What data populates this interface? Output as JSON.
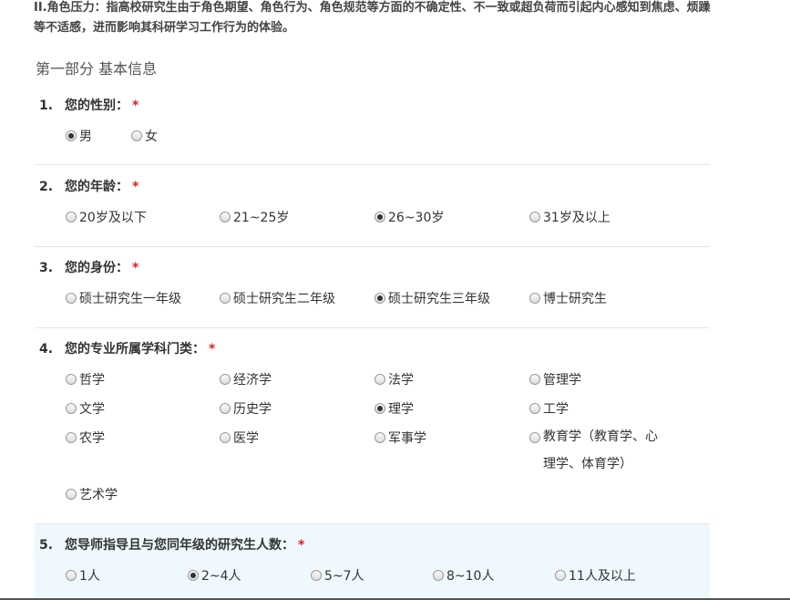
{
  "intro_text": "II.角色压力：指高校研究生由于角色期望、角色行为、角色规范等方面的不确定性、不一致或超负荷而引起内心感知到焦虑、烦躁等不适感，进而影响其科研学习工作行为的体验。",
  "part_title": "第一部分 基本信息",
  "required_mark": "*",
  "questions": [
    {
      "num": "1.",
      "text": "您的性别：",
      "options": [
        "男",
        "女"
      ],
      "selected": 0
    },
    {
      "num": "2.",
      "text": "您的年龄：",
      "options": [
        "20岁及以下",
        "21~25岁",
        "26~30岁",
        "31岁及以上"
      ],
      "selected": 2
    },
    {
      "num": "3.",
      "text": "您的身份：",
      "options": [
        "硕士研究生一年级",
        "硕士研究生二年级",
        "硕士研究生三年级",
        "博士研究生"
      ],
      "selected": 2
    },
    {
      "num": "4.",
      "text": "您的专业所属学科门类：",
      "options": [
        "哲学",
        "经济学",
        "法学",
        "管理学",
        "文学",
        "历史学",
        "理学",
        "工学",
        "农学",
        "医学",
        "军事学",
        "教育学（教育学、心理学、体育学）",
        "艺术学"
      ],
      "selected": 6
    },
    {
      "num": "5.",
      "text": "您导师指导且与您同年级的研究生人数：",
      "options": [
        "1人",
        "2~4人",
        "5~7人",
        "8~10人",
        "11人及以上"
      ],
      "selected": 1
    }
  ]
}
